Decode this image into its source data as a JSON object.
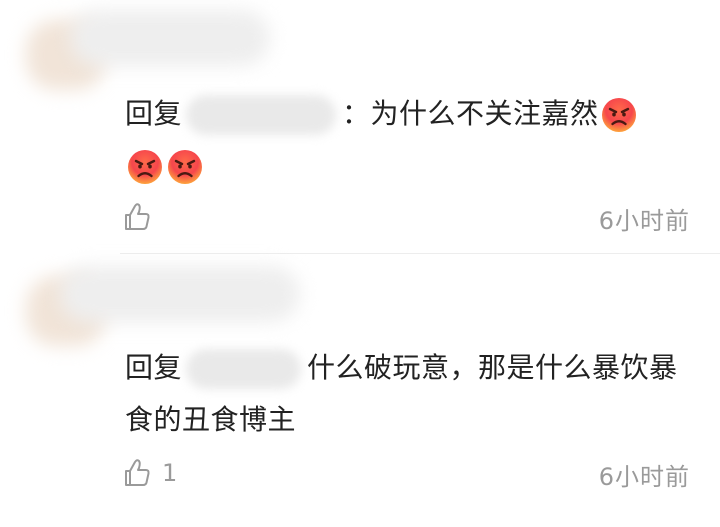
{
  "comments": [
    {
      "prefix": "回复",
      "colon": "：为什么不关注嘉然",
      "likes": "",
      "time": "6小时前",
      "emoji": "angry-face"
    },
    {
      "prefix": "回复",
      "body": "什么破玩意，那是什么暴饮暴食的丑食博主",
      "likes": "1",
      "time": "6小时前"
    }
  ],
  "colors": {
    "text": "#222222",
    "meta": "#9a9a9a",
    "divider": "#ededed",
    "emoji_top": "#ff3b30",
    "emoji_bottom": "#ffb23e"
  }
}
